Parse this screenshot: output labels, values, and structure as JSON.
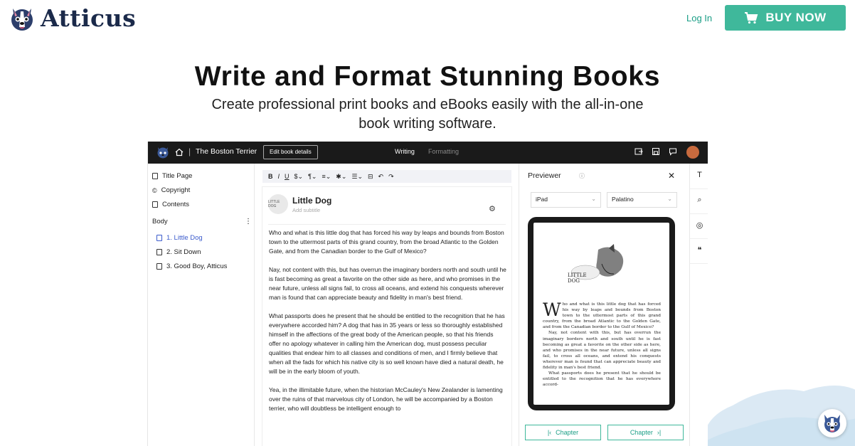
{
  "header": {
    "logo_text": "Atticus",
    "login_label": "Log In",
    "buy_label": "BUY NOW",
    "accent_color": "#3fb89b"
  },
  "hero": {
    "title": "Write and Format Stunning Books",
    "subtitle": "Create professional print books and eBooks easily with the all-in-one book writing software."
  },
  "app": {
    "book_title": "The Boston Terrier",
    "edit_details_label": "Edit book details",
    "mode_writing": "Writing",
    "mode_formatting": "Formatting",
    "sidebar": {
      "front_matter": [
        {
          "label": "Title Page",
          "icon": "page-icon"
        },
        {
          "label": "Copyright",
          "icon": "copyright-icon"
        },
        {
          "label": "Contents",
          "icon": "page-icon"
        }
      ],
      "body_label": "Body",
      "chapters": [
        {
          "label": "1. Little Dog",
          "active": true
        },
        {
          "label": "2. Sit Down",
          "active": false
        },
        {
          "label": "3. Good Boy, Atticus",
          "active": false
        }
      ]
    },
    "toolbar": {
      "bold": "B",
      "italic": "I",
      "underline": "U",
      "dollar": "$",
      "pilcrow": "¶",
      "align": "≡",
      "special": "✱",
      "list": "☰",
      "undo": "↶",
      "redo": "↷"
    },
    "editor": {
      "chapter_badge": "LITTLE DOG",
      "chapter_title": "Little Dog",
      "subtitle_placeholder": "Add subtitle",
      "paragraphs": [
        "Who and what is this little dog that has forced his way by leaps and bounds from Boston town to the uttermost parts of this grand country, from the broad Atlantic to the Golden Gate, and from the Canadian border to the Gulf of Mexico?",
        "Nay, not content with this, but has overrun the imaginary borders north and south until he is fast becoming as great a favorite on the other side as here, and who promises in the near future, unless all signs fail, to cross all oceans, and extend his conquests wherever man is found that can appreciate beauty and fidelity in man's best friend.",
        "What passports does he present that he should be entitled to the recognition that he has everywhere accorded him? A dog that has in 35 years or less so thoroughly established himself in the affections of the great body of the American people, so that his friends offer no apology whatever in calling him the American dog, must possess peculiar qualities that endear him to all classes and conditions of men, and I firmly believe that when all the fads for which his native city is so well known have died a natural death, he will be in the early bloom of youth.",
        " Yea, in the illimitable future, when the historian McCauley's New Zealander is lamenting over the ruins of that marvelous city of London, he will be accompanied by a Boston terrier, who will doubtless be intelligent enough to"
      ]
    },
    "previewer": {
      "title": "Previewer",
      "device": "iPad",
      "font": "Palatino",
      "preview_heading": "LITTLE DOG",
      "preview_dropcap": "W",
      "preview_p1": "ho and what is this little dog that has forced his way by leaps and bounds from Boston town to the uttermost parts of this grand country, from the broad Atlantic to the Golden Gate, and from the Canadian border to the Gulf of Mexico?",
      "preview_p2": "Nay, not content with this, but has overrun the imaginary borders north and south until he is fast becoming as great a favorite on the other side as here, and who promises in the near future, unless all signs fail, to cross all oceans, and extend his conquests wherever man is found that can appreciate beauty and fidelity in man's best friend.",
      "preview_p3": "What passports does he present that he should be entitled to the recognition that he has everywhere accord-",
      "prev_chapter": "Chapter",
      "next_chapter": "Chapter"
    }
  }
}
